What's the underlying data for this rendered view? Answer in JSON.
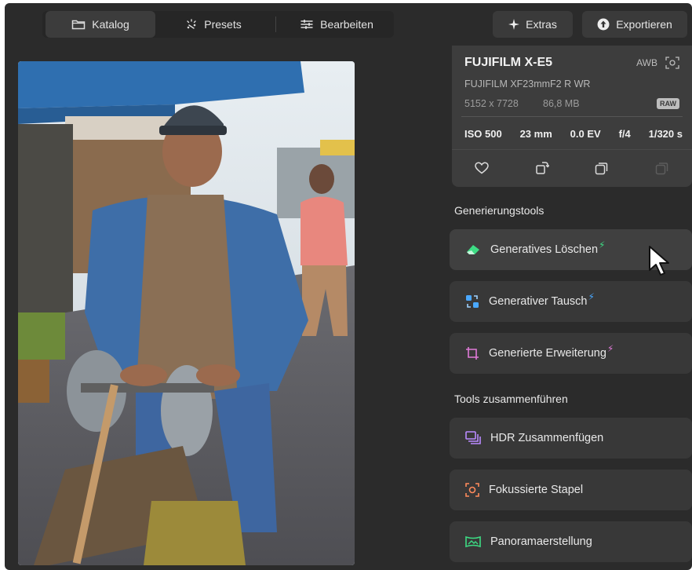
{
  "toolbar": {
    "tabs": [
      {
        "label": "Katalog",
        "icon": "folder-icon",
        "active": true
      },
      {
        "label": "Presets",
        "icon": "sparkle-icon",
        "active": false
      },
      {
        "label": "Bearbeiten",
        "icon": "sliders-icon",
        "active": false
      }
    ],
    "extras_label": "Extras",
    "export_label": "Exportieren"
  },
  "photo_info": {
    "camera": "FUJIFILM X-E5",
    "white_balance": "AWB",
    "lens": "FUJIFILM XF23mmF2 R WR",
    "resolution": "5152 x 7728",
    "file_size": "86,8 MB",
    "format": "RAW",
    "iso": "ISO 500",
    "focal_length": "23 mm",
    "exposure_comp": "0.0 EV",
    "aperture": "f/4",
    "shutter": "1/320 s"
  },
  "generation": {
    "title": "Generierungstools",
    "tools": [
      {
        "label": "Generatives Löschen",
        "icon": "eraser-icon",
        "badge": "⚡",
        "badge_color": "#3ddc84"
      },
      {
        "label": "Generativer Tausch",
        "icon": "swap-icon",
        "badge": "⚡",
        "badge_color": "#4aa8ff"
      },
      {
        "label": "Generierte Erweiterung",
        "icon": "expand-icon",
        "badge": "⚡",
        "badge_color": "#e07ad8"
      }
    ]
  },
  "merge": {
    "title": "Tools zusammenführen",
    "tools": [
      {
        "label": "HDR Zusammenfügen",
        "icon": "hdr-stack-icon"
      },
      {
        "label": "Fokussierte Stapel",
        "icon": "focus-stack-icon"
      },
      {
        "label": "Panoramaerstellung",
        "icon": "panorama-icon"
      }
    ]
  },
  "colors": {
    "background": "#2b2b2b",
    "panel": "#383838",
    "accent_green": "#3ddc84",
    "accent_blue": "#4aa8ff",
    "accent_pink": "#e07ad8"
  }
}
